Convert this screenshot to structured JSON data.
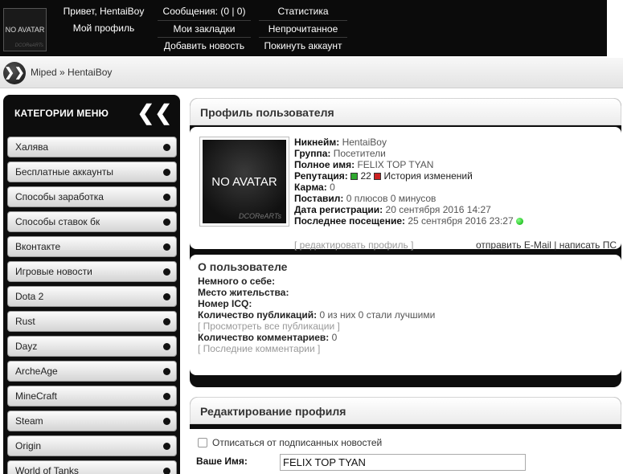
{
  "header": {
    "avatar_text": "NO AVATAR",
    "avatar_watermark": "DCOReARTs",
    "col1": [
      "Привет, HentaiBoy",
      "Мой профиль"
    ],
    "col2": [
      "Сообщения: (0 | 0)",
      "Мои закладки",
      "Добавить новость"
    ],
    "col3": [
      "Статистика",
      "Непрочитанное",
      "Покинуть аккаунт"
    ]
  },
  "breadcrumb": {
    "button_glyph": "❯❯",
    "site": "Miped",
    "separator": " » ",
    "current": "HentaiBoy"
  },
  "sidebar": {
    "title": "КАТЕГОРИИ МЕНЮ",
    "collapse_glyph": "❮❮",
    "items": [
      "Халява",
      "Бесплатные аккаунты",
      "Способы заработка",
      "Способы ставок бк",
      "Вконтакте",
      "Игровые новости",
      "Dota 2",
      "Rust",
      "Dayz",
      "ArcheAge",
      "MineCraft",
      "Steam",
      "Origin",
      "World of Tanks"
    ]
  },
  "profile": {
    "title": "Профиль пользователя",
    "avatar_text": "NO AVATAR",
    "avatar_watermark": "DCOReARTs",
    "nick_label": "Никнейм:",
    "nick": "HentaiBoy",
    "group_label": "Группа:",
    "group": "Посетители",
    "fullname_label": "Полное имя:",
    "fullname": "FELIX TOP TYAN",
    "rep_label": "Репутация:",
    "rep_value": "22",
    "rep_history": "История изменений",
    "karma_label": "Карма:",
    "karma": "0",
    "voted_label": "Поставил:",
    "voted": "0 плюсов 0 минусов",
    "reg_label": "Дата регистрации:",
    "reg": "20 сентября 2016 14:27",
    "last_label": "Последнее посещение:",
    "last": "25 сентября 2016 23:27",
    "edit_link": "[ редактировать профиль ]",
    "email_link": "отправить E-Mail",
    "contact_sep": " | ",
    "pm_link": "написать ПС"
  },
  "about": {
    "title": "О пользователе",
    "about_label": "Немного о себе:",
    "city_label": "Место жительства:",
    "icq_label": "Номер ICQ:",
    "pubs_label": "Количество публикаций:",
    "pubs": "0 из них 0 стали лучшими",
    "pubs_link": "[ Просмотреть все публикации ]",
    "comments_label": "Количество комментариев:",
    "comments": "0",
    "comments_link": "[ Последние комментарии ]"
  },
  "edit": {
    "title": "Редактирование профиля",
    "unsubscribe_label": "Отписаться от подписанных новостей",
    "unsubscribe_checked": false,
    "name_label": "Ваше Имя:",
    "name_value": "FELIX TOP TYAN"
  }
}
